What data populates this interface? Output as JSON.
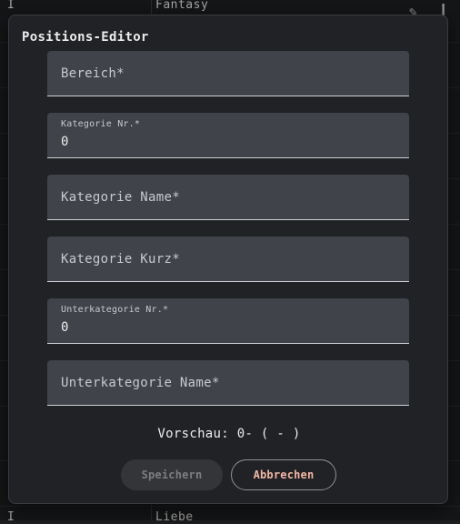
{
  "background": {
    "rows": [
      {
        "left": "I",
        "right": "Fantasy"
      },
      {
        "left": "I",
        "right": "Liebe"
      }
    ]
  },
  "dialog": {
    "title": "Positions-Editor",
    "fields": [
      {
        "label": "Bereich*",
        "value": "",
        "floating": false
      },
      {
        "label": "Kategorie Nr.*",
        "value": "0",
        "floating": true
      },
      {
        "label": "Kategorie Name*",
        "value": "",
        "floating": false
      },
      {
        "label": "Kategorie Kurz*",
        "value": "",
        "floating": false
      },
      {
        "label": "Unterkategorie Nr.*",
        "value": "0",
        "floating": true
      },
      {
        "label": "Unterkategorie Name*",
        "value": "",
        "floating": false
      }
    ],
    "preview_label": "Vorschau:",
    "preview_value": "0- ( - )",
    "buttons": {
      "save": "Speichern",
      "cancel": "Abbrechen"
    }
  },
  "colors": {
    "accent_text": "#f1b6a6",
    "field_bg": "#404349",
    "dialog_bg": "#212225"
  }
}
